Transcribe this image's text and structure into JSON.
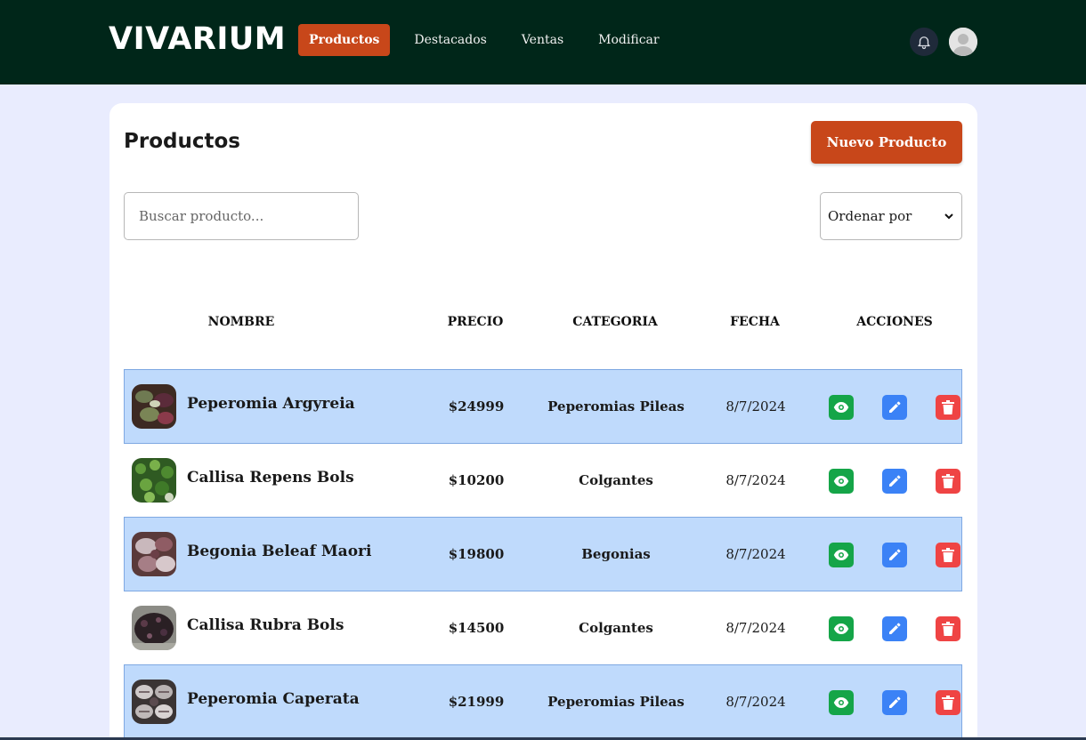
{
  "header": {
    "brand": "VIVARIUM",
    "nav": [
      {
        "label": "Productos",
        "active": true
      },
      {
        "label": "Destacados",
        "active": false
      },
      {
        "label": "Ventas",
        "active": false
      },
      {
        "label": "Modificar",
        "active": false
      }
    ],
    "icons": {
      "notifications": "bell-icon",
      "profile": "avatar-icon"
    }
  },
  "main": {
    "title": "Productos",
    "new_button_label": "Nuevo Producto",
    "search": {
      "placeholder": "Buscar producto...",
      "value": ""
    },
    "sort": {
      "selected": "Ordenar por"
    },
    "table": {
      "headers": [
        "NOMBRE",
        "PRECIO",
        "CATEGORIA",
        "FECHA",
        "ACCIONES"
      ],
      "rows": [
        {
          "name": "Peperomia Argyreia",
          "price": "$24999",
          "category": "Peperomias Pileas",
          "date": "8/7/2024",
          "highlighted": true
        },
        {
          "name": "Callisa Repens Bols",
          "price": "$10200",
          "category": "Colgantes",
          "date": "8/7/2024",
          "highlighted": false
        },
        {
          "name": "Begonia Beleaf Maori",
          "price": "$19800",
          "category": "Begonias",
          "date": "8/7/2024",
          "highlighted": true
        },
        {
          "name": "Callisa Rubra Bols",
          "price": "$14500",
          "category": "Colgantes",
          "date": "8/7/2024",
          "highlighted": false
        },
        {
          "name": "Peperomia Caperata",
          "price": "$21999",
          "category": "Peperomias Pileas",
          "date": "8/7/2024",
          "highlighted": true
        }
      ],
      "action_icons": [
        "eye-icon",
        "pencil-icon",
        "trash-icon"
      ]
    }
  },
  "colors": {
    "topbar": "#002619",
    "accent": "#c8471a",
    "page_bg": "#e9ecfe",
    "row_highlight": "#bfdafc",
    "view": "#15a548",
    "edit": "#3b82f6",
    "delete": "#ef4444"
  }
}
